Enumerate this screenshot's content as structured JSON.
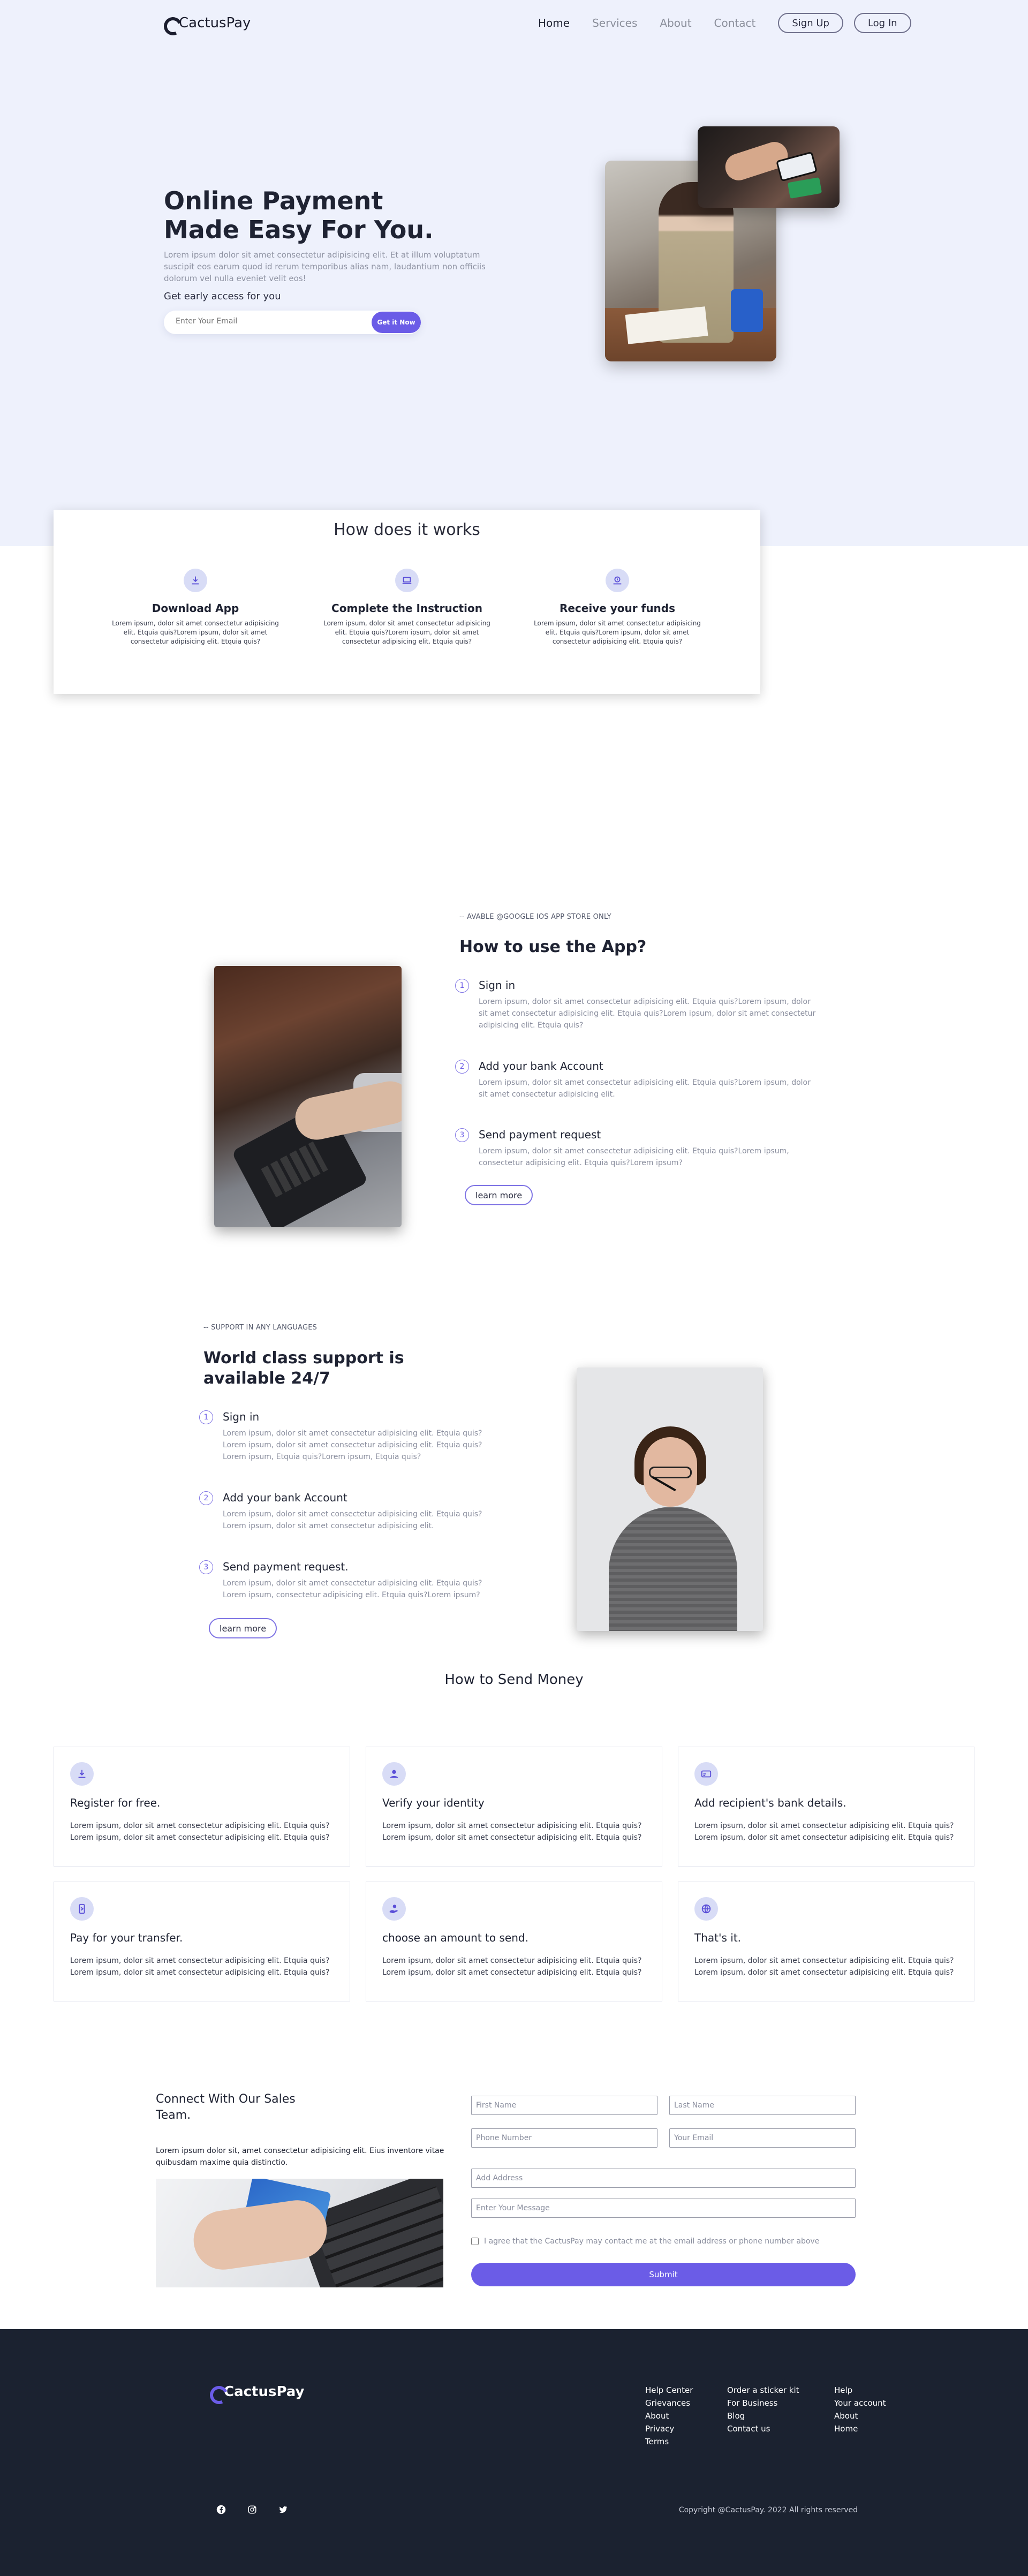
{
  "header": {
    "logo": "CactusPay",
    "nav": [
      "Home",
      "Services",
      "About",
      "Contact"
    ],
    "sign_up": "Sign Up",
    "log_in": "Log In"
  },
  "hero": {
    "title": "Online Payment Made Easy For You.",
    "text": "Lorem ipsum dolor sit amet consectetur adipisicing elit. Et at illum voluptatum suscipit eos earum quod id rerum temporibus alias nam, laudantium non officiis dolorum vel nulla eveniet velit eos!",
    "subtitle": "Get early access for you",
    "email_placeholder": "Enter Your Email",
    "cta": "Get it Now"
  },
  "how_it_works": {
    "title": "How does it works",
    "items": [
      {
        "icon": "download-icon",
        "title": "Download App",
        "text": "Lorem ipsum, dolor sit amet consectetur adipisicing elit. Etquia quis?Lorem ipsum, dolor sit amet consectetur adipisicing elit. Etquia quis?"
      },
      {
        "icon": "laptop-icon",
        "title": "Complete the Instruction",
        "text": "Lorem ipsum, dolor sit amet consectetur adipisicing elit. Etquia quis?Lorem ipsum, dolor sit amet consectetur adipisicing elit. Etquia quis?"
      },
      {
        "icon": "funds-icon",
        "title": "Receive your funds",
        "text": "Lorem ipsum, dolor sit amet consectetur adipisicing elit. Etquia quis?Lorem ipsum, dolor sit amet consectetur adipisicing elit. Etquia quis?"
      }
    ]
  },
  "app_section": {
    "eyebrow": "-- AVABLE @GOOGLE IOS APP STORE ONLY",
    "title": "How to use the App?",
    "steps": [
      {
        "num": "1",
        "title": "Sign in",
        "text": "Lorem ipsum, dolor sit amet consectetur adipisicing elit. Etquia quis?Lorem ipsum, dolor sit amet consectetur adipisicing elit. Etquia quis?Lorem ipsum, dolor sit amet consectetur adipisicing elit. Etquia quis?"
      },
      {
        "num": "2",
        "title": "Add your bank Account",
        "text": "Lorem ipsum, dolor sit amet consectetur adipisicing elit. Etquia quis?Lorem ipsum, dolor sit amet consectetur adipisicing elit."
      },
      {
        "num": "3",
        "title": "Send payment request",
        "text": "Lorem ipsum, dolor sit amet consectetur adipisicing elit. Etquia quis?Lorem ipsum, consectetur adipisicing elit. Etquia quis?Lorem ipsum?"
      }
    ],
    "button": "learn more"
  },
  "support_section": {
    "eyebrow": "-- SUPPORT IN ANY LANGUAGES",
    "title": "World class support is available 24/7",
    "steps": [
      {
        "num": "1",
        "title": "Sign in",
        "text": "Lorem ipsum, dolor sit amet consectetur adipisicing elit. Etquia quis? Lorem ipsum, dolor sit amet consectetur adipisicing elit. Etquia quis? Lorem ipsum, Etquia quis?Lorem ipsum, Etquia quis?"
      },
      {
        "num": "2",
        "title": "Add your bank Account",
        "text": "Lorem ipsum, dolor sit amet consectetur adipisicing elit. Etquia quis? Lorem ipsum, dolor sit amet consectetur adipisicing elit."
      },
      {
        "num": "3",
        "title": "Send payment request.",
        "text": "Lorem ipsum, dolor sit amet consectetur adipisicing elit. Etquia quis? Lorem ipsum, consectetur adipisicing elit. Etquia quis?Lorem ipsum?"
      }
    ],
    "button": "learn more"
  },
  "send_money": {
    "title": "How to Send Money",
    "cards": [
      {
        "icon": "download-icon",
        "title": "Register for free.",
        "text": "Lorem ipsum, dolor sit amet consectetur adipisicing elit. Etquia quis? Lorem ipsum, dolor sit amet consectetur adipisicing elit. Etquia quis?"
      },
      {
        "icon": "user-icon",
        "title": "Verify your identity",
        "text": "Lorem ipsum, dolor sit amet consectetur adipisicing elit. Etquia quis? Lorem ipsum, dolor sit amet consectetur adipisicing elit. Etquia quis?"
      },
      {
        "icon": "bank-card-icon",
        "title": "Add recipient's bank details.",
        "text": "Lorem ipsum, dolor sit amet consectetur adipisicing elit. Etquia quis? Lorem ipsum, dolor sit amet consectetur adipisicing elit. Etquia quis?"
      },
      {
        "icon": "transfer-icon",
        "title": "Pay for your transfer.",
        "text": "Lorem ipsum, dolor sit amet consectetur adipisicing elit. Etquia quis? Lorem ipsum, dolor sit amet consectetur adipisicing elit. Etquia quis?"
      },
      {
        "icon": "hand-coin-icon",
        "title": "choose an amount to send.",
        "text": "Lorem ipsum, dolor sit amet consectetur adipisicing elit. Etquia quis? Lorem ipsum, dolor sit amet consectetur adipisicing elit. Etquia quis?"
      },
      {
        "icon": "globe-icon",
        "title": "That's it.",
        "text": "Lorem ipsum, dolor sit amet consectetur adipisicing elit. Etquia quis? Lorem ipsum, dolor sit amet consectetur adipisicing elit. Etquia quis?"
      }
    ]
  },
  "contact": {
    "title": "Connect With Our Sales Team.",
    "text": "Lorem ipsum dolor sit, amet consectetur adipisicing elit. Eius inventore vitae quibusdam maxime quia distinctio.",
    "first_name": "First Name",
    "last_name": "Last Name",
    "phone": "Phone Number",
    "email": "Your Email",
    "address": "Add Address",
    "message": "Enter Your Message",
    "agree": "I agree that the CactusPay may contact me at the email address or phone number above",
    "submit": "Submit"
  },
  "footer": {
    "logo": "CactusPay",
    "col1": [
      "Help Center",
      "Grievances",
      "About",
      "Privacy",
      "Terms"
    ],
    "col2": [
      "Order a sticker kit",
      "For Business",
      "Blog",
      "Contact us"
    ],
    "col3": [
      "Help",
      "Your account",
      "About",
      "Home"
    ],
    "socials": [
      "facebook-icon",
      "instagram-icon",
      "twitter-icon"
    ],
    "copyright": "Copyright @CactusPay. 2022 All rights reserved"
  },
  "colors": {
    "accent": "#6b5ce7",
    "hero_bg": "#eef1fc",
    "footer_bg": "#1b2230",
    "icon_bg": "#d8dcf6"
  }
}
